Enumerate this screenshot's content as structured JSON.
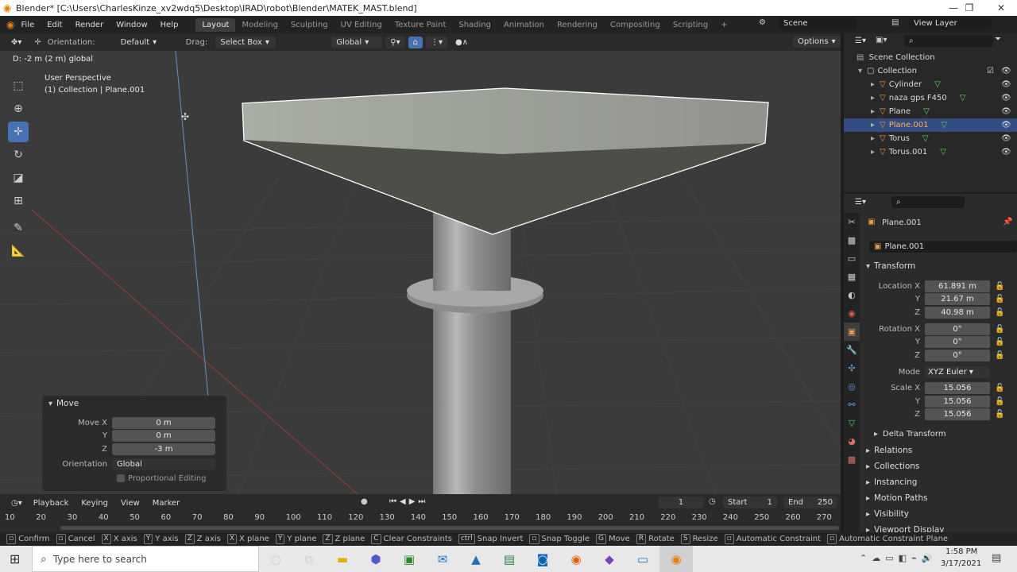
{
  "window": {
    "title": "Blender* [C:\\Users\\CharlesKinze_xv2wdq5\\Desktop\\IRAD\\robot\\Blender\\MATEK_MAST.blend]"
  },
  "menu": [
    "File",
    "Edit",
    "Render",
    "Window",
    "Help"
  ],
  "workspaces": [
    "Layout",
    "Modeling",
    "Sculpting",
    "UV Editing",
    "Texture Paint",
    "Shading",
    "Animation",
    "Rendering",
    "Compositing",
    "Scripting"
  ],
  "scene": {
    "label": "Scene",
    "view_layer": "View Layer"
  },
  "header": {
    "orientation_label": "Orientation:",
    "orientation_value": "Default",
    "drag_label": "Drag:",
    "drag_value": "Select Box",
    "transform_orientation": "Global",
    "options": "Options"
  },
  "viewport": {
    "status_text": "D: -2 m (2 m) global",
    "view_name": "User Perspective",
    "view_collection": "(1) Collection | Plane.001"
  },
  "move_panel": {
    "title": "Move",
    "rows": [
      {
        "label": "Move X",
        "value": "0 m"
      },
      {
        "label": "Y",
        "value": "0 m"
      },
      {
        "label": "Z",
        "value": "-3 m"
      }
    ],
    "orientation_label": "Orientation",
    "orientation_value": "Global",
    "proportional": "Proportional Editing"
  },
  "outliner": {
    "root": "Scene Collection",
    "collection": "Collection",
    "items": [
      "Cylinder",
      "naza gps F450",
      "Plane",
      "Plane.001",
      "Torus",
      "Torus.001"
    ],
    "selected": "Plane.001"
  },
  "properties": {
    "object_name": "Plane.001",
    "object_field": "Plane.001",
    "transform_title": "Transform",
    "location": [
      {
        "label": "Location X",
        "value": "61.891 m"
      },
      {
        "label": "Y",
        "value": "21.67 m"
      },
      {
        "label": "Z",
        "value": "40.98 m"
      }
    ],
    "rotation": [
      {
        "label": "Rotation X",
        "value": "0°"
      },
      {
        "label": "Y",
        "value": "0°"
      },
      {
        "label": "Z",
        "value": "0°"
      }
    ],
    "mode_label": "Mode",
    "mode_value": "XYZ Euler",
    "scale": [
      {
        "label": "Scale X",
        "value": "15.056"
      },
      {
        "label": "Y",
        "value": "15.056"
      },
      {
        "label": "Z",
        "value": "15.056"
      }
    ],
    "delta": "Delta Transform",
    "sections": [
      "Relations",
      "Collections",
      "Instancing",
      "Motion Paths",
      "Visibility",
      "Viewport Display"
    ]
  },
  "timeline": {
    "menus": [
      "Playback",
      "Keying",
      "View",
      "Marker"
    ],
    "current_frame": "1",
    "start_label": "Start",
    "start": "1",
    "end_label": "End",
    "end": "250",
    "ticks": [
      "10",
      "20",
      "30",
      "40",
      "50",
      "60",
      "70",
      "80",
      "90",
      "100",
      "110",
      "120",
      "130",
      "140",
      "150",
      "160",
      "170",
      "180",
      "190",
      "200",
      "210",
      "220",
      "230",
      "240",
      "250",
      "260",
      "270"
    ]
  },
  "statusbar": [
    {
      "key": "",
      "text": "Confirm"
    },
    {
      "key": "",
      "text": "Cancel"
    },
    {
      "key": "X",
      "text": "X axis"
    },
    {
      "key": "Y",
      "text": "Y axis"
    },
    {
      "key": "Z",
      "text": "Z axis"
    },
    {
      "key": "X",
      "text": "X plane"
    },
    {
      "key": "Y",
      "text": "Y plane"
    },
    {
      "key": "Z",
      "text": "Z plane"
    },
    {
      "key": "C",
      "text": "Clear Constraints"
    },
    {
      "key": "ctrl",
      "text": "Snap Invert"
    },
    {
      "key": "",
      "text": "Snap Toggle"
    },
    {
      "key": "G",
      "text": "Move"
    },
    {
      "key": "R",
      "text": "Rotate"
    },
    {
      "key": "S",
      "text": "Resize"
    },
    {
      "key": "",
      "text": "Automatic Constraint"
    },
    {
      "key": "",
      "text": "Automatic Constraint Plane"
    }
  ],
  "taskbar": {
    "search_placeholder": "Type here to search",
    "time": "1:58 PM",
    "date": "3/17/2021"
  },
  "colors": {
    "accent": "#4772b3",
    "viewport_bg": "#3b3b3b",
    "mesh_icon": "#6ad06a",
    "object_icon": "#e79a4a"
  }
}
